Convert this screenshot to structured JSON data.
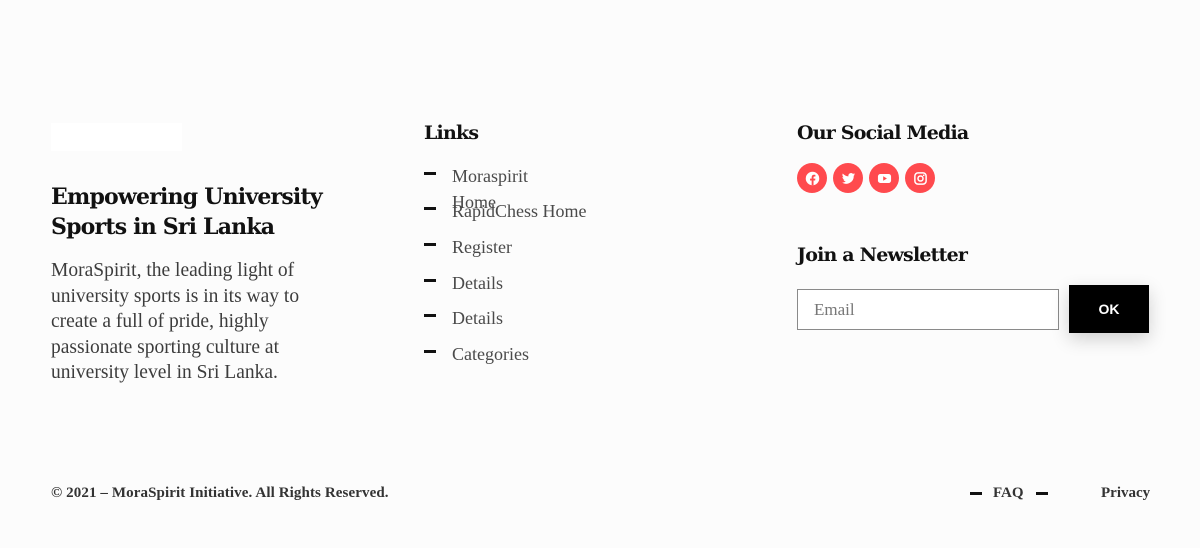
{
  "brand": {
    "tagline": "Empowering University Sports in Sri Lanka",
    "about": "MoraSpirit, the leading light of university sports is in its way to create a full of pride, highly passionate sporting culture at university level in Sri Lanka."
  },
  "links": {
    "title": "Links",
    "items": [
      {
        "label": "Moraspirit Home"
      },
      {
        "label": "RapidChess Home"
      },
      {
        "label": "Register"
      },
      {
        "label": "Details"
      },
      {
        "label": "Details"
      },
      {
        "label": "Categories"
      }
    ]
  },
  "social": {
    "title": "Our Social Media",
    "icons": [
      "facebook-icon",
      "twitter-icon",
      "youtube-icon",
      "instagram-icon"
    ],
    "accent_color": "#ff4a4e"
  },
  "newsletter": {
    "title": "Join a Newsletter",
    "email_placeholder": "Email",
    "submit_label": "OK"
  },
  "footer": {
    "copyright": "© 2021 – MoraSpirit Initiative. All Rights Reserved.",
    "faq_label": "FAQ",
    "privacy_label": "Privacy"
  }
}
